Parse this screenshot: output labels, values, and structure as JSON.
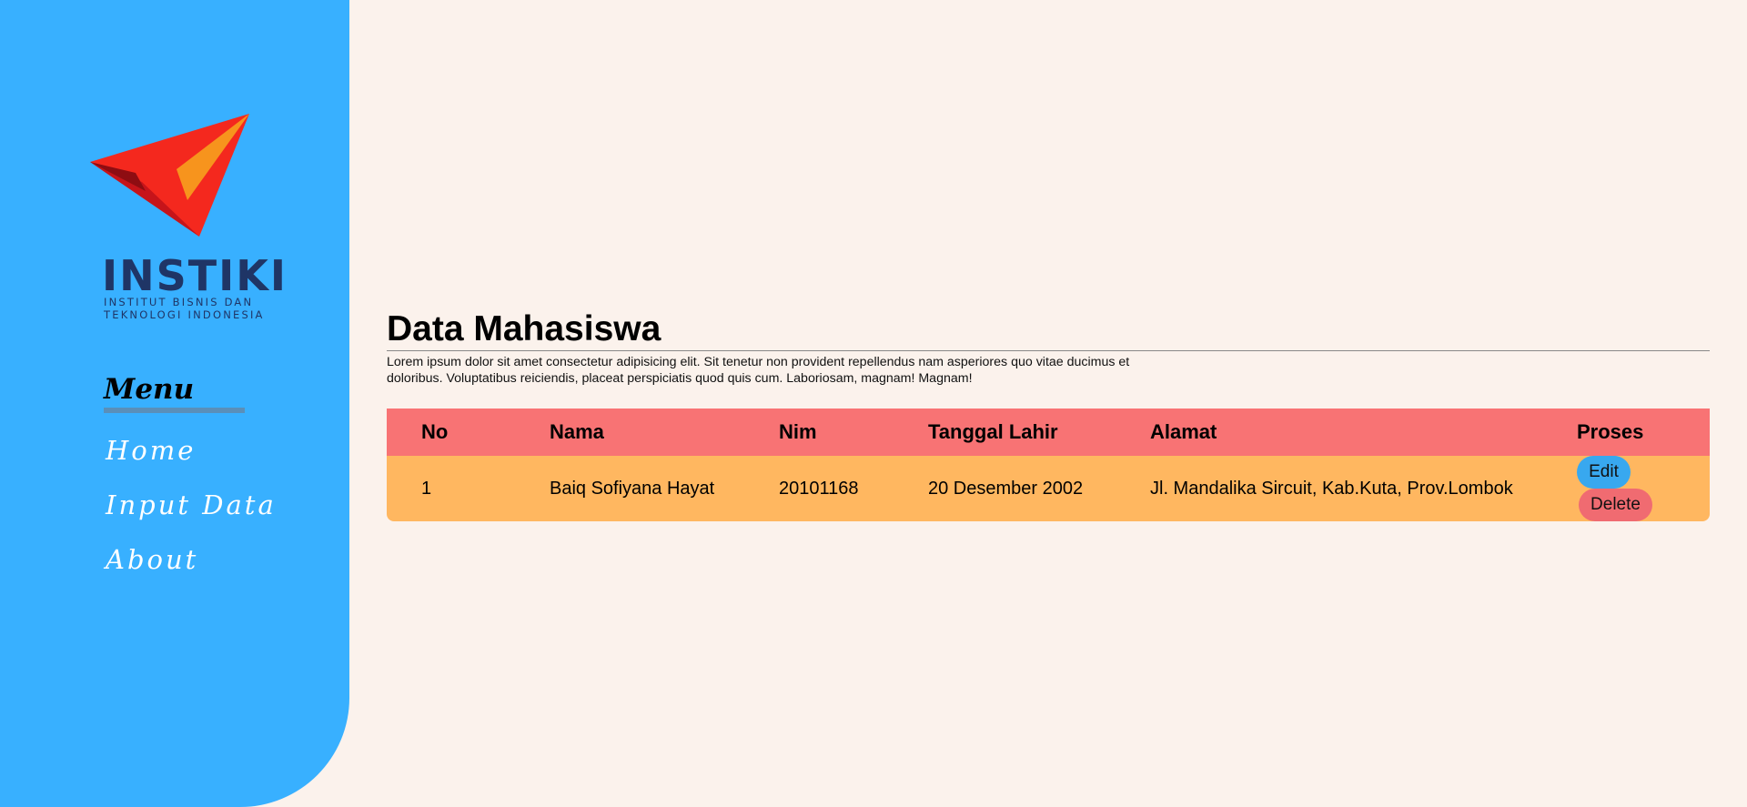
{
  "sidebar": {
    "logo": {
      "wordmark": "INSTIKI",
      "sub_line1": "INSTITUT BISNIS DAN",
      "sub_line2": "TEKNOLOGI INDONESIA",
      "icon": "checkmark-bird-logo",
      "colors": [
        "#d61920",
        "#f4281e",
        "#f7941d",
        "#1f3566"
      ]
    },
    "menu_title": "Menu",
    "items": [
      {
        "label": "Home"
      },
      {
        "label": "Input Data"
      },
      {
        "label": "About"
      }
    ],
    "background": "#38b0ff"
  },
  "main": {
    "title": "Data Mahasiswa",
    "description": "Lorem ipsum dolor sit amet consectetur adipisicing elit. Sit tenetur non provident repellendus nam asperiores quo vitae ducimus et doloribus. Voluptatibus reiciendis, placeat perspiciatis quod quis cum. Laboriosam, magnam! Magnam!",
    "table": {
      "headers": [
        "No",
        "Nama",
        "Nim",
        "Tanggal Lahir",
        "Alamat",
        "Proses"
      ],
      "rows": [
        {
          "no": "1",
          "nama": "Baiq Sofiyana Hayat",
          "nim": "20101168",
          "tanggal_lahir": "20 Desember 2002",
          "alamat": "Jl. Mandalika Sircuit, Kab.Kuta, Prov.Lombok",
          "edit_label": "Edit",
          "delete_label": "Delete"
        }
      ],
      "header_color": "#f87374",
      "row_color": "#ffb760"
    }
  },
  "colors": {
    "page_background": "#fbf2ec",
    "edit_button": "#38a8ef",
    "delete_button": "#f06b71"
  }
}
